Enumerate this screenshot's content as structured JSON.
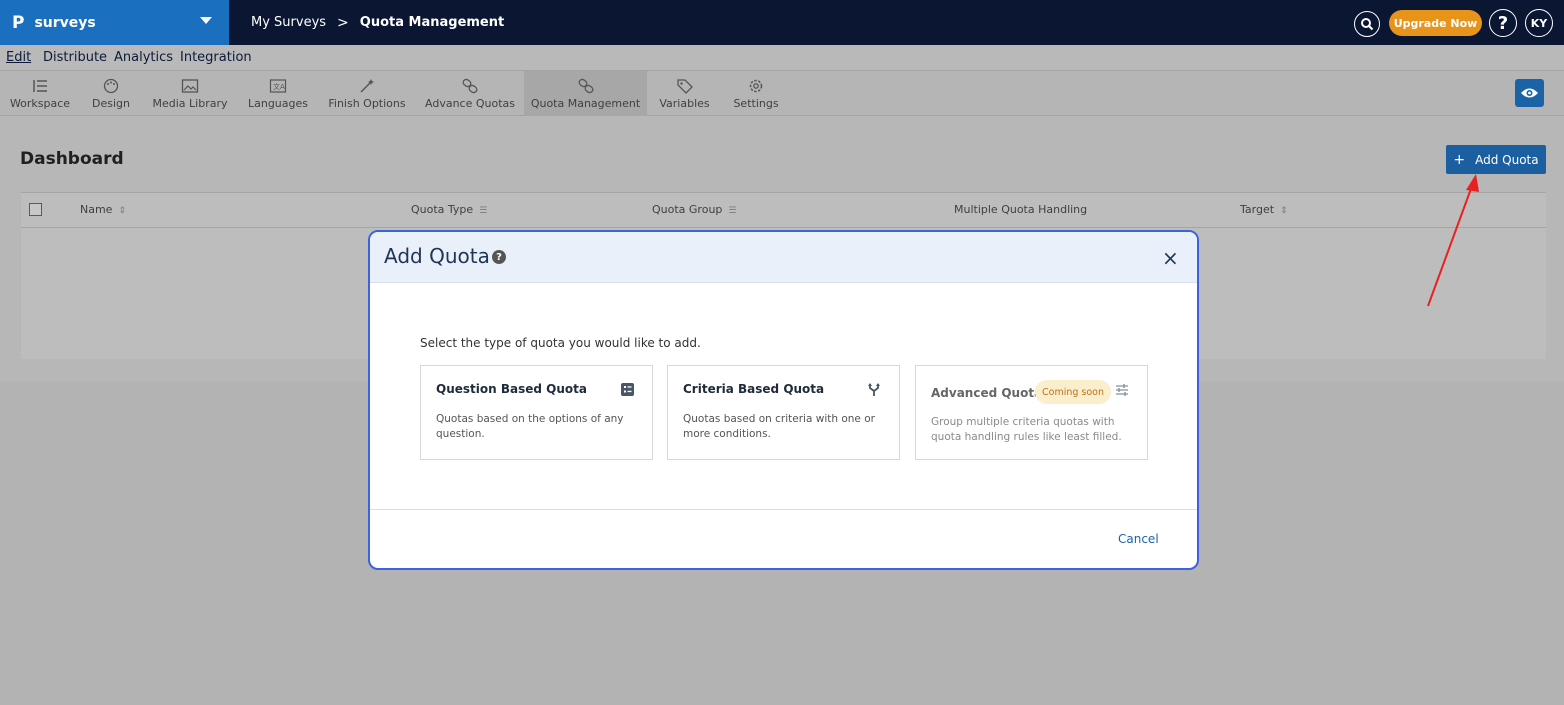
{
  "app": {
    "logo": "P",
    "name": "surveys"
  },
  "breadcrumb": {
    "root": "My Surveys",
    "separator": ">",
    "current": "Quota Management"
  },
  "header": {
    "upgrade_label": "Upgrade Now",
    "help_label": "?",
    "avatar_initials": "KY"
  },
  "menu": {
    "edit": "Edit",
    "distribute": "Distribute",
    "analytics": "Analytics",
    "integration": "Integration"
  },
  "toolbar": {
    "items": [
      {
        "label": "Workspace",
        "icon": "workspace-icon"
      },
      {
        "label": "Design",
        "icon": "palette-icon"
      },
      {
        "label": "Media Library",
        "icon": "image-icon"
      },
      {
        "label": "Languages",
        "icon": "translate-icon"
      },
      {
        "label": "Finish Options",
        "icon": "magic-wand-icon"
      },
      {
        "label": "Advance Quotas",
        "icon": "link-icon"
      },
      {
        "label": "Quota Management",
        "icon": "link-icon",
        "active": true
      },
      {
        "label": "Variables",
        "icon": "tag-icon"
      },
      {
        "label": "Settings",
        "icon": "gear-icon"
      }
    ]
  },
  "dashboard": {
    "title": "Dashboard",
    "add_quota_label": "Add Quota",
    "columns": [
      "Name",
      "Quota Type",
      "Quota Group",
      "Multiple Quota Handling",
      "Target"
    ]
  },
  "modal": {
    "title": "Add Quota",
    "help_icon": "?",
    "close_label": "×",
    "subtitle": "Select the type of quota you would like to add.",
    "cards": [
      {
        "title": "Question Based Quota",
        "description": "Quotas based on the options of any question.",
        "icon": "list-icon"
      },
      {
        "title": "Criteria Based Quota",
        "description": "Quotas based on criteria with one or more conditions.",
        "icon": "branch-icon"
      },
      {
        "title": "Advanced Quota",
        "badge": "Coming soon",
        "description": "Group multiple criteria quotas with quota handling rules like least filled.",
        "icon": "sliders-icon",
        "disabled": true
      }
    ],
    "cancel_label": "Cancel"
  },
  "colors": {
    "brand": "#1b6fbf",
    "topbar": "#0b1633",
    "accent": "#1b5fa0",
    "upgrade": "#e8941a",
    "arrow": "#e82020",
    "modal_border": "#3b63e0"
  }
}
